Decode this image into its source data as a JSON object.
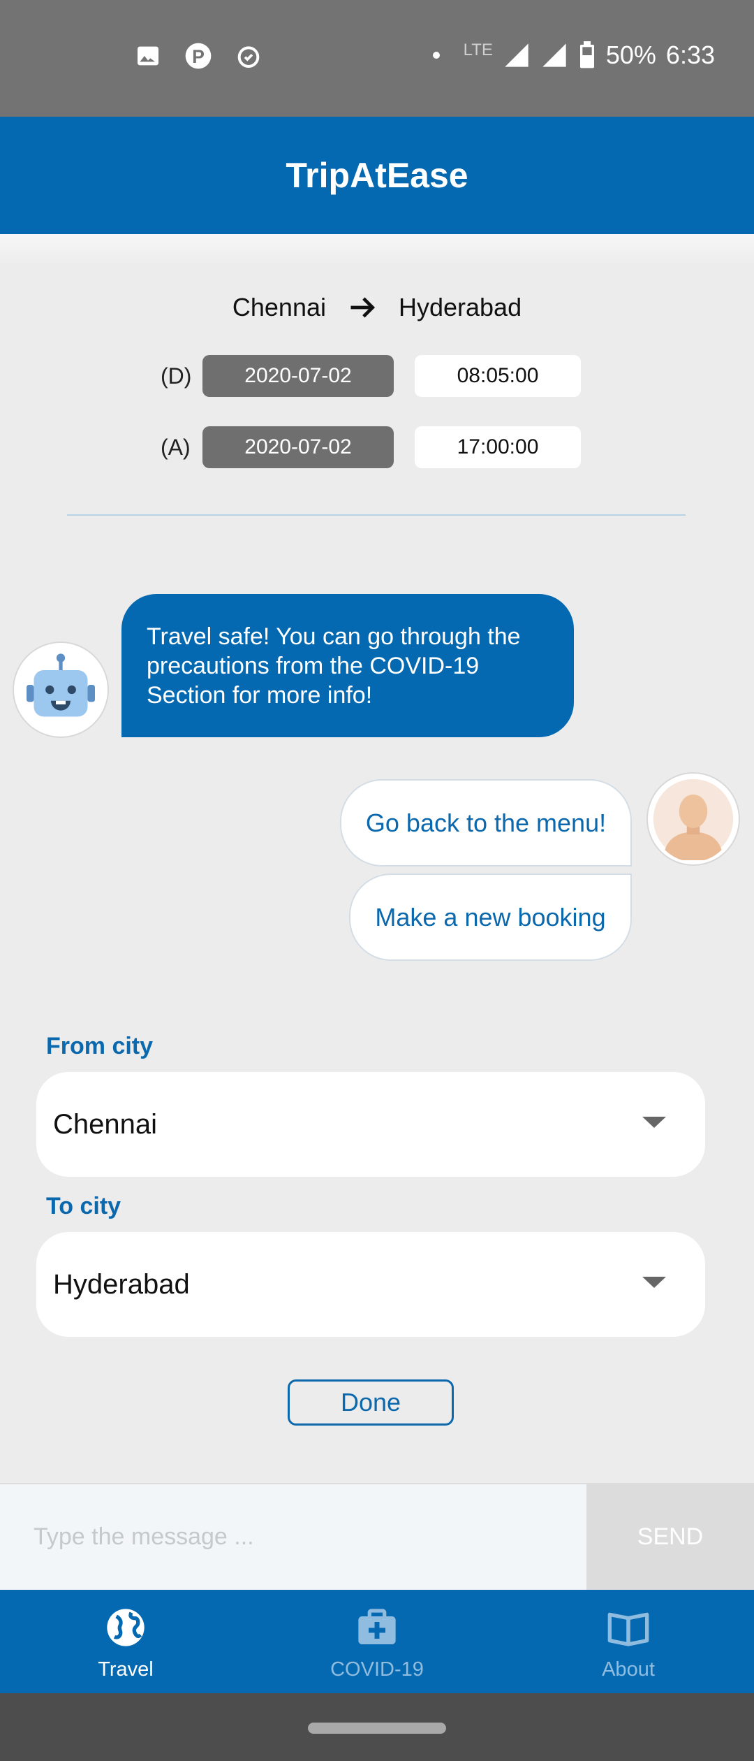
{
  "status_bar": {
    "network": "LTE",
    "battery": "50%",
    "time": "6:33"
  },
  "app": {
    "title": "TripAtEase"
  },
  "itinerary": {
    "from": "Chennai",
    "to": "Hyderabad",
    "departure": {
      "label": "(D)",
      "date": "2020-07-02",
      "time": "08:05:00"
    },
    "arrival": {
      "label": "(A)",
      "date": "2020-07-02",
      "time": "17:00:00"
    }
  },
  "chat": {
    "bot_message": "Travel safe! You can go through the precautions from the COVID-19 Section for more info!",
    "options": [
      "Go back to the menu!",
      "Make a new booking"
    ]
  },
  "form": {
    "from_label": "From city",
    "from_value": "Chennai",
    "to_label": "To city",
    "to_value": "Hyderabad",
    "done_label": "Done"
  },
  "input": {
    "placeholder": "Type the message ...",
    "send_label": "SEND"
  },
  "nav": {
    "items": [
      {
        "label": "Travel",
        "icon": "globe-icon",
        "active": true
      },
      {
        "label": "COVID-19",
        "icon": "medical-kit-icon",
        "active": false
      },
      {
        "label": "About",
        "icon": "book-icon",
        "active": false
      }
    ]
  },
  "colors": {
    "primary": "#0469b0",
    "date_pill": "#6f6f6f",
    "accent_text": "#0b68ad"
  }
}
